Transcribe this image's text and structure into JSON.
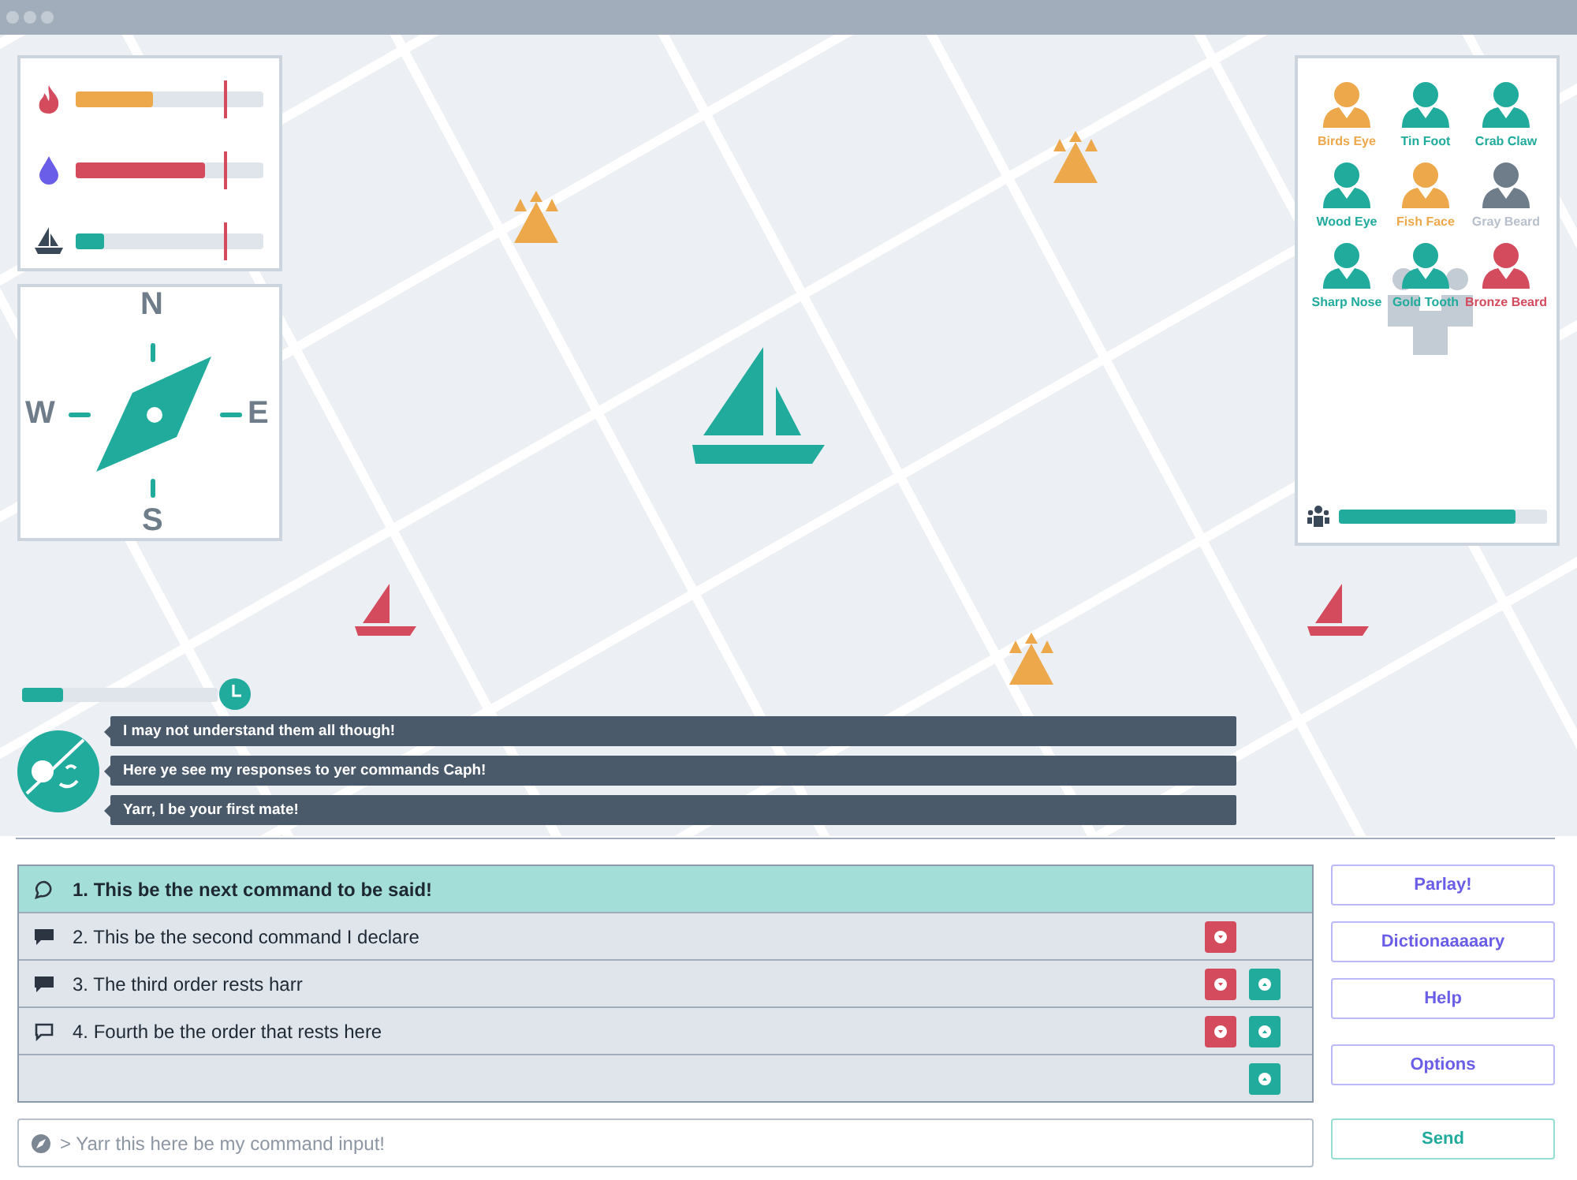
{
  "stats": [
    {
      "kind": "fire",
      "level": 0.41,
      "color": "#eda84c"
    },
    {
      "kind": "water",
      "level": 0.69,
      "color": "#d44b5e"
    },
    {
      "kind": "ship",
      "level": 0.15,
      "color": "#20ab9c"
    }
  ],
  "compass": {
    "north": "N",
    "east": "E",
    "south": "S",
    "west": "W"
  },
  "crew": [
    {
      "name": "Birds Eye",
      "color": "#eda84c",
      "inactive": false
    },
    {
      "name": "Tin Foot",
      "color": "#20ab9c",
      "inactive": false
    },
    {
      "name": "Crab Claw",
      "color": "#20ab9c",
      "inactive": false
    },
    {
      "name": "Wood Eye",
      "color": "#20ab9c",
      "inactive": false
    },
    {
      "name": "Fish Face",
      "color": "#eda84c",
      "inactive": false
    },
    {
      "name": "Gray Beard",
      "color": "#6f7c8a",
      "inactive": true
    },
    {
      "name": "Sharp Nose",
      "color": "#20ab9c",
      "inactive": false
    },
    {
      "name": "Gold Tooth",
      "color": "#20ab9c",
      "inactive": false
    },
    {
      "name": "Bronze Beard",
      "color": "#d44b5e",
      "inactive": false
    }
  ],
  "crew_level": {
    "level": 0.85
  },
  "timer": {
    "level": 0.21
  },
  "chat": [
    "I may not understand them all though!",
    "Here ye see my responses to yer commands Caph!",
    "Yarr, I be your first mate!"
  ],
  "commands": [
    {
      "text": "1. This be the next command to be said!",
      "kind": "round",
      "selected": true,
      "can_move_down": false,
      "can_move_up": false
    },
    {
      "text": "2. This be the second command I declare",
      "kind": "filled",
      "selected": false,
      "can_move_down": true,
      "can_move_up": false
    },
    {
      "text": "3. The third order rests harr",
      "kind": "filled",
      "selected": false,
      "can_move_down": true,
      "can_move_up": true
    },
    {
      "text": "4. Fourth be the order that rests here",
      "kind": "outline",
      "selected": false,
      "can_move_down": true,
      "can_move_up": true
    },
    {
      "kind": "empty",
      "selected": false,
      "can_move_down": false,
      "can_move_up": true
    }
  ],
  "buttons": [
    "Parlay!",
    "Dictionaaaaary",
    "Help",
    "Options"
  ],
  "input": {
    "placeholder": "> Yarr this here be my command input!"
  },
  "send": "Send"
}
